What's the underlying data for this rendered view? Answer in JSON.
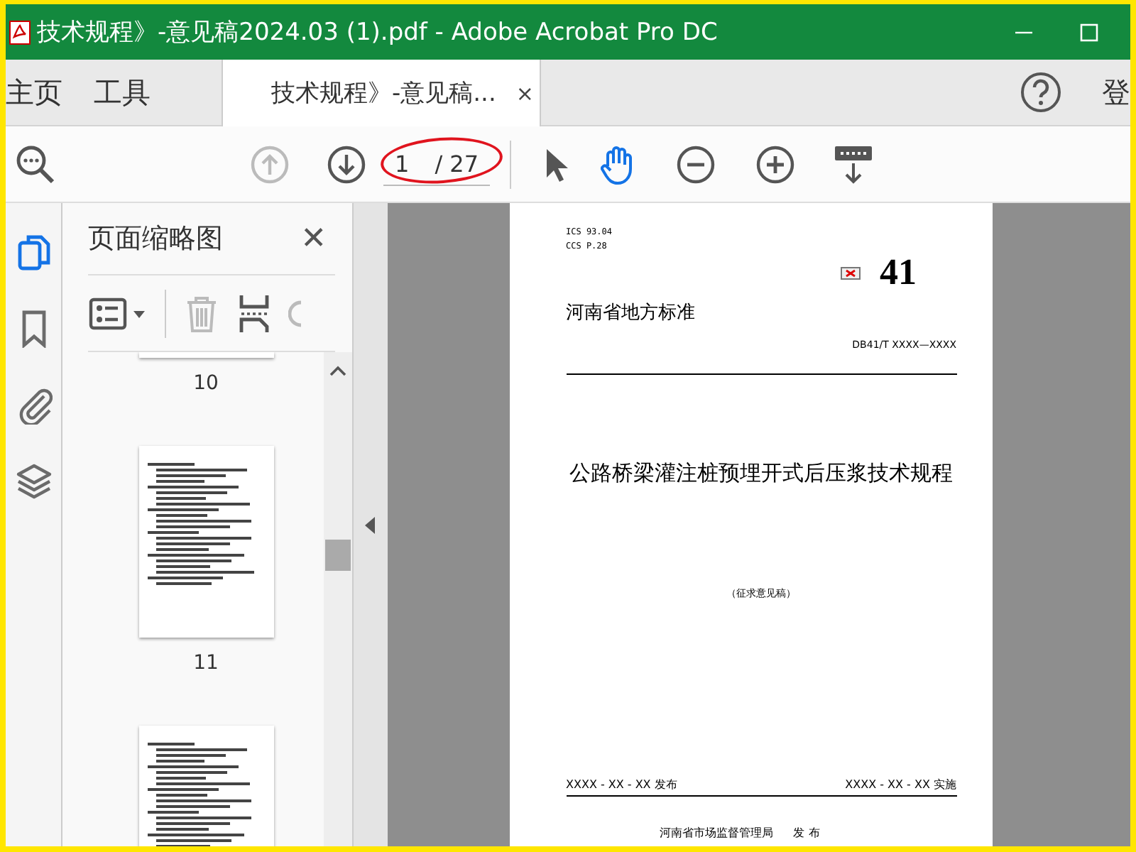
{
  "window": {
    "title": "技术规程》-意见稿2024.03 (1).pdf - Adobe Acrobat Pro DC"
  },
  "tabs": [
    {
      "label": "主页",
      "selected": false,
      "kind": "nav"
    },
    {
      "label": "工具",
      "selected": false,
      "kind": "nav"
    },
    {
      "label": "技术规程》-意见稿...",
      "selected": true,
      "kind": "document",
      "close": "×"
    }
  ],
  "account": {
    "label": "登"
  },
  "toolbar": {
    "page_current": "1",
    "page_total": "/ 27",
    "tools": [
      {
        "kind": "select",
        "selected": false
      },
      {
        "kind": "hand",
        "selected": true
      }
    ]
  },
  "rail": [
    {
      "kind": "pages",
      "selected": true
    },
    {
      "kind": "bookmarks",
      "selected": false
    },
    {
      "kind": "attachments",
      "selected": false
    },
    {
      "kind": "layers",
      "selected": false
    }
  ],
  "panel": {
    "title": "页面缩略图",
    "close": "✕",
    "thumbnails": [
      {
        "label": "10",
        "kind": "cut-top"
      },
      {
        "label": "11",
        "kind": "full"
      },
      {
        "kind": "cut-bottom"
      }
    ]
  },
  "document": {
    "ics": "ICS  93.04",
    "ccs": "CCS  P.28",
    "code": "41",
    "category": "河南省地方标准",
    "number": "DB41/T XXXX—XXXX",
    "title": "公路桥梁灌注桩预埋开式后压浆技术规程",
    "status": "（征求意见稿）",
    "issue_date": "XXXX - XX - XX 发布",
    "effective_date": "XXXX - XX - XX 实施",
    "issuer": "河南省市场监督管理局",
    "issuer_action": "发  布"
  }
}
